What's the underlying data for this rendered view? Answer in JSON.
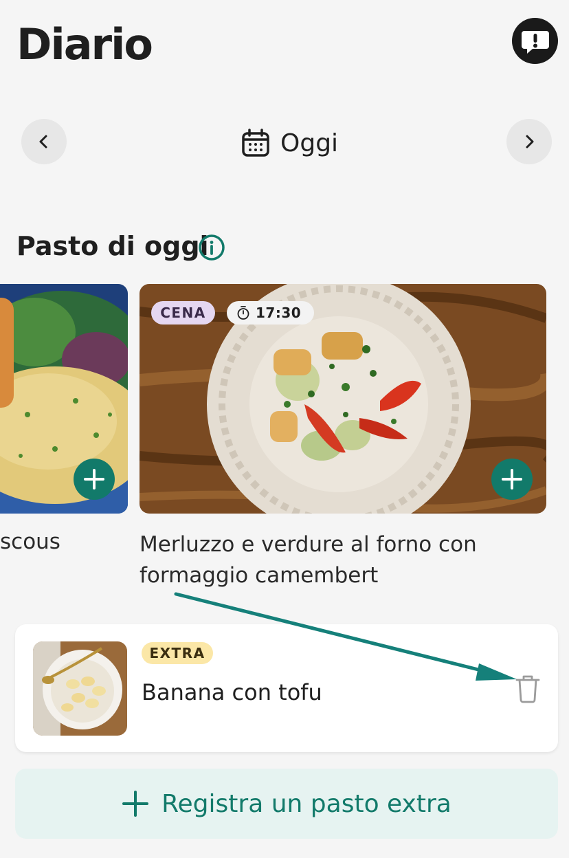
{
  "header": {
    "title": "Diario"
  },
  "date_nav": {
    "label": "Oggi"
  },
  "section": {
    "title": "Pasto di oggi"
  },
  "meals": [
    {
      "name": "scous"
    },
    {
      "tag": "CENA",
      "time": "17:30",
      "name": "Merluzzo e verdure al forno con formaggio camembert"
    }
  ],
  "extra": {
    "tag": "EXTRA",
    "name": "Banana con tofu"
  },
  "register": {
    "label": "Registra un pasto extra"
  },
  "colors": {
    "accent": "#127a6a",
    "cena_pill": "#e5d7f1",
    "extra_pill": "#fbe7a7",
    "register_bg": "#e6f3f1"
  }
}
